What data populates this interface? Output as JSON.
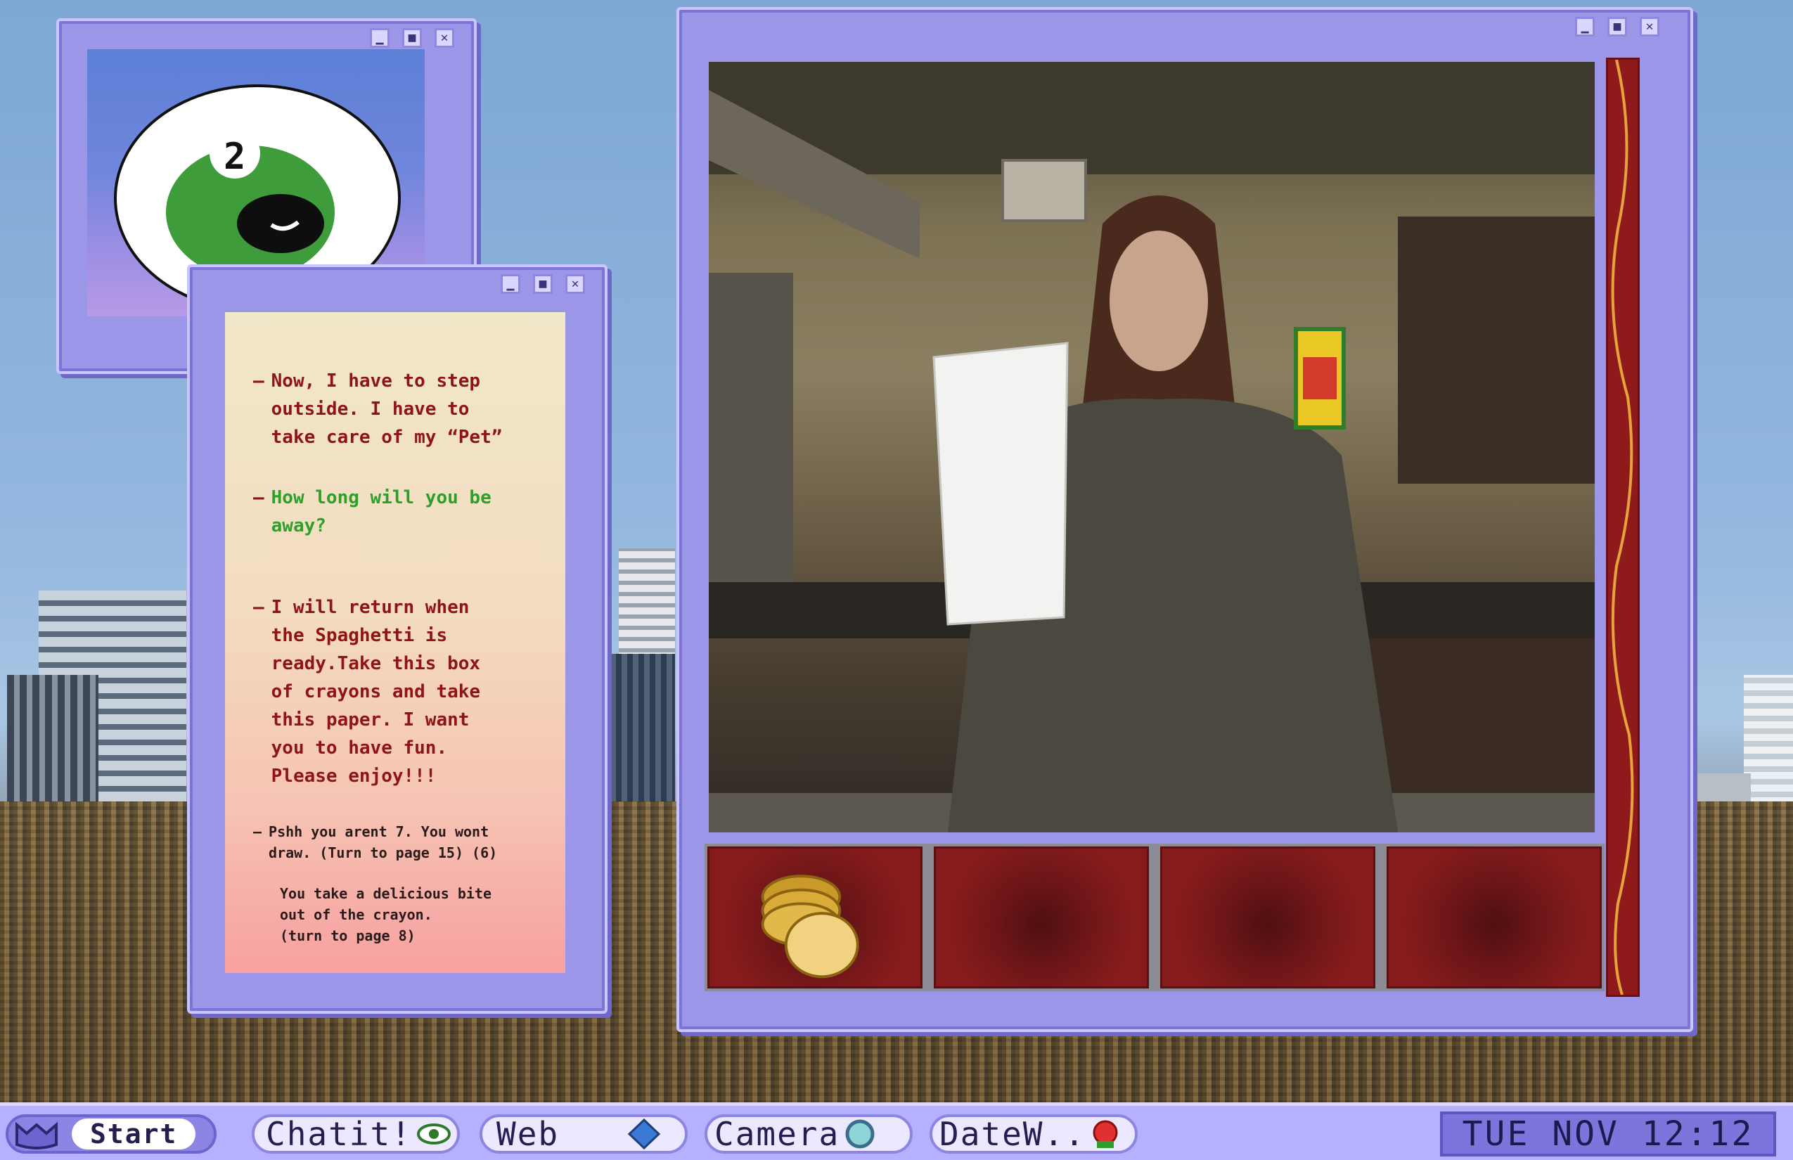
{
  "pet_window": {
    "pet_number": "2"
  },
  "story_window": {
    "dialog": [
      {
        "dash": "—",
        "text": "Now, I have to step\noutside. I have to\ntake care of my “Pet”",
        "color": "#8f1414"
      },
      {
        "dash": "—",
        "text": "How long will you be\naway?",
        "color": "#2f9e2a"
      },
      {
        "dash": "—",
        "text": "I will return when\nthe Spaghetti is\nready.Take this box\nof crayons and take\nthis paper. I want\nyou to have fun.\nPlease enjoy!!!",
        "color": "#8f1414"
      }
    ],
    "choices": [
      {
        "dash": "—",
        "text": "Pshh you arent 7. You wont\ndraw. (Turn to page 15) (6)"
      },
      {
        "dash": "",
        "text": "You take a delicious bite\nout of the crayon.\n(turn to page 8)"
      }
    ]
  },
  "window_controls": {
    "minimize": "▁",
    "maximize": "■",
    "close": "✕"
  },
  "inventory": {
    "slots": [
      {
        "item": "gold-coins"
      },
      {
        "item": ""
      },
      {
        "item": ""
      },
      {
        "item": ""
      }
    ]
  },
  "taskbar": {
    "start_label": "Start",
    "apps": [
      {
        "label": "Chatit!",
        "icon": "eye-icon"
      },
      {
        "label": "Web",
        "icon": "diamond-icon"
      },
      {
        "label": "Camera",
        "icon": "lens-icon"
      },
      {
        "label": "DateW..",
        "icon": "flower-icon"
      }
    ],
    "clock": "TUE NOV 12:12"
  },
  "colors": {
    "window": "#9b96e8",
    "window_border": "#c9c5ff",
    "speech_red": "#8f1414",
    "speech_green": "#2f9e2a",
    "inventory_red": "#861b1c",
    "taskbar": "#b6b1ff"
  }
}
